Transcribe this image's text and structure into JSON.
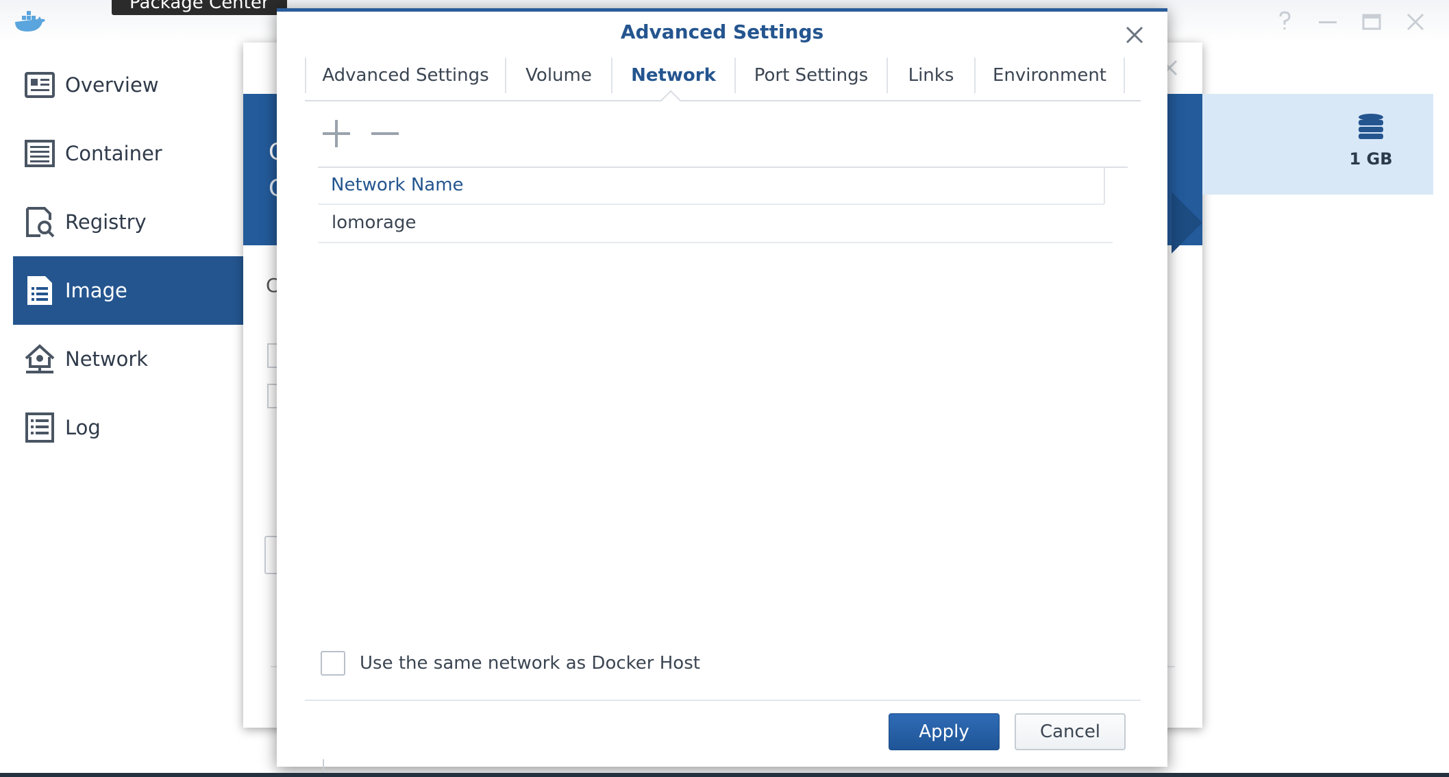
{
  "app": {
    "tooltip": "Package Center"
  },
  "sidebar": {
    "items": [
      {
        "label": "Overview",
        "icon": "overview-icon"
      },
      {
        "label": "Container",
        "icon": "container-icon"
      },
      {
        "label": "Registry",
        "icon": "registry-icon"
      },
      {
        "label": "Image",
        "icon": "image-icon",
        "active": true
      },
      {
        "label": "Network",
        "icon": "network-icon"
      },
      {
        "label": "Log",
        "icon": "log-icon"
      }
    ]
  },
  "background": {
    "letters": [
      "C",
      "C",
      "C"
    ],
    "storage": "1 GB"
  },
  "dialog": {
    "title": "Advanced Settings",
    "tabs": [
      "Advanced Settings",
      "Volume",
      "Network",
      "Port Settings",
      "Links",
      "Environment"
    ],
    "active_tab": "Network",
    "grid": {
      "column_header": "Network Name",
      "rows": [
        "lomorage"
      ]
    },
    "checkbox_label": "Use the same network as Docker Host",
    "checkbox_checked": false,
    "apply_label": "Apply",
    "cancel_label": "Cancel"
  },
  "colors": {
    "accent": "#24558f",
    "banner": "#235b9b",
    "panel": "#d9e8f7",
    "primary_button": "#2563a6"
  }
}
